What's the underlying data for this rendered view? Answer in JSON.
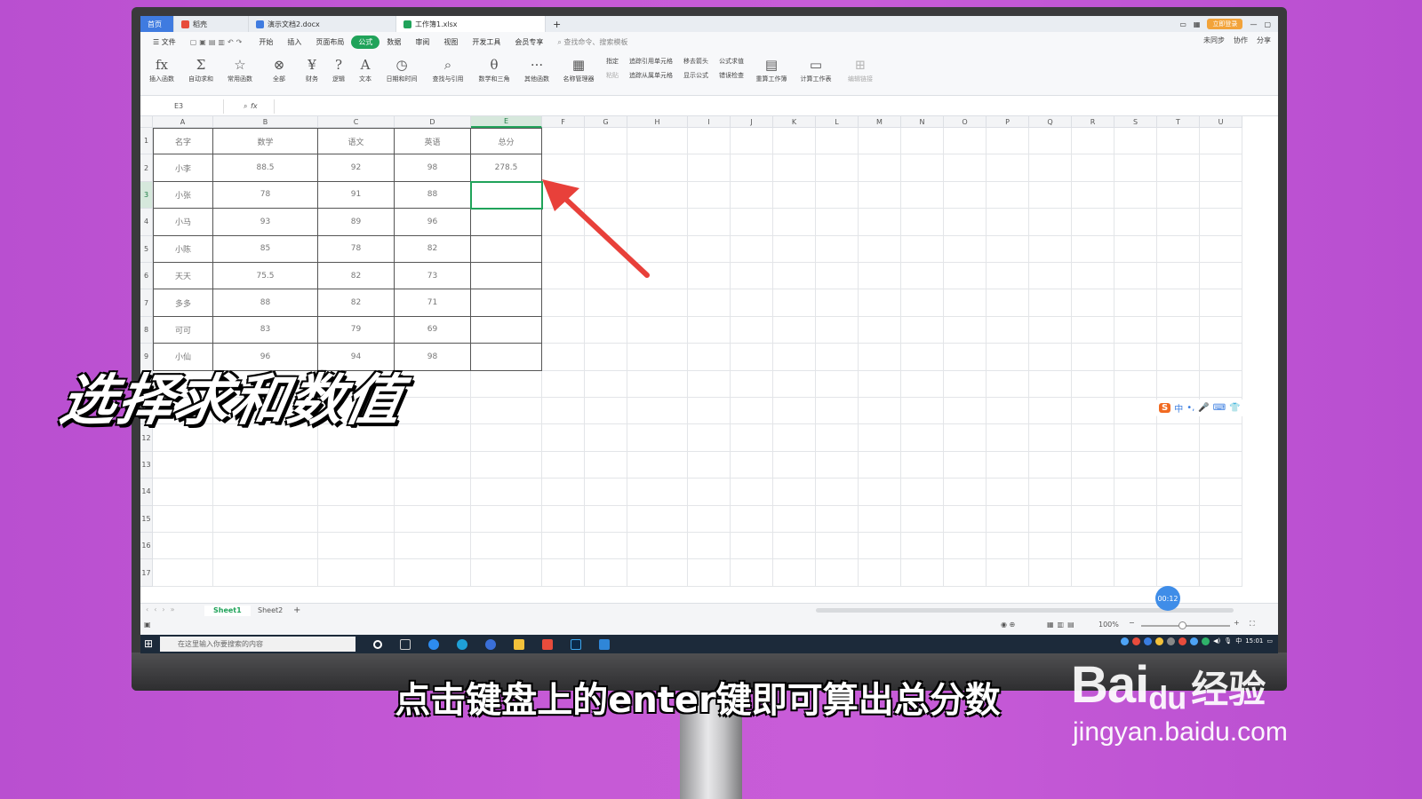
{
  "app": {
    "tabs": [
      {
        "label": "首页",
        "kind": "home"
      },
      {
        "label": "稻壳",
        "kind": "daoke"
      },
      {
        "label": "演示文档2.docx",
        "kind": "doc"
      },
      {
        "label": "工作簿1.xlsx",
        "kind": "xls"
      }
    ],
    "login_label": "立即登录",
    "menu": [
      "文件",
      "开始",
      "插入",
      "页面布局",
      "公式",
      "数据",
      "审阅",
      "视图",
      "开发工具",
      "会员专享"
    ],
    "active_menu": "公式",
    "search_placeholder": "查找命令、搜索模板",
    "right_actions": [
      "未同步",
      "协作",
      "分享"
    ],
    "ribbon_big": [
      {
        "label": "插入函数",
        "icon": "fx-icon",
        "glyph": "fx"
      },
      {
        "label": "自动求和",
        "icon": "sigma-icon",
        "glyph": "Σ"
      },
      {
        "label": "常用函数",
        "icon": "star-icon",
        "glyph": "☆"
      },
      {
        "label": "全部",
        "icon": "all-functions-icon",
        "glyph": "⊗"
      },
      {
        "label": "财务",
        "icon": "finance-icon",
        "glyph": "¥"
      },
      {
        "label": "逻辑",
        "icon": "logic-icon",
        "glyph": "?"
      },
      {
        "label": "文本",
        "icon": "text-icon",
        "glyph": "A"
      },
      {
        "label": "日期和时间",
        "icon": "clock-icon",
        "glyph": "◷"
      },
      {
        "label": "查找与引用",
        "icon": "lookup-icon",
        "glyph": "🔍"
      },
      {
        "label": "数学和三角",
        "icon": "math-icon",
        "glyph": "θ"
      },
      {
        "label": "其他函数",
        "icon": "more-icon",
        "glyph": "···"
      },
      {
        "label": "名称管理器",
        "icon": "name-manager-icon",
        "glyph": "▦"
      }
    ],
    "ribbon_small": [
      [
        "指定",
        "粘贴"
      ],
      [
        "追踪引用单元格",
        "追踪从属单元格"
      ],
      [
        "移去箭头",
        "显示公式"
      ],
      [
        "公式求值",
        "错误检查"
      ]
    ],
    "ribbon_tail": [
      {
        "label": "重算工作簿",
        "icon": "recalc-icon",
        "glyph": "▤"
      },
      {
        "label": "计算工作表",
        "icon": "calc-sheet-icon",
        "glyph": "▭"
      },
      {
        "label": "编辑链接",
        "icon": "edit-links-icon",
        "glyph": "⊞"
      }
    ],
    "namebox": "E3",
    "fx_label": "fx"
  },
  "sheet": {
    "columns": [
      "A",
      "B",
      "C",
      "D",
      "E",
      "F",
      "G",
      "H",
      "I",
      "J",
      "K",
      "L",
      "M",
      "N",
      "O",
      "P",
      "Q",
      "R",
      "S",
      "T",
      "U"
    ],
    "rows": [
      "1",
      "2",
      "3",
      "4",
      "5",
      "6",
      "7",
      "8",
      "9",
      "10",
      "11",
      "12",
      "13",
      "14",
      "15",
      "16",
      "17"
    ],
    "selected_col": "E",
    "selected_row": "3",
    "table": [
      [
        "名字",
        "数学",
        "语文",
        "英语",
        "总分"
      ],
      [
        "小李",
        "88.5",
        "92",
        "98",
        "278.5"
      ],
      [
        "小张",
        "78",
        "91",
        "88",
        ""
      ],
      [
        "小马",
        "93",
        "89",
        "96",
        ""
      ],
      [
        "小陈",
        "85",
        "78",
        "82",
        ""
      ],
      [
        "天天",
        "75.5",
        "82",
        "73",
        ""
      ],
      [
        "多多",
        "88",
        "82",
        "71",
        ""
      ],
      [
        "可可",
        "83",
        "79",
        "69",
        ""
      ],
      [
        "小仙",
        "96",
        "94",
        "98",
        ""
      ]
    ],
    "sheet_tabs": [
      "Sheet1",
      "Sheet2"
    ],
    "active_sheet": "Sheet1",
    "add_sheet": "+",
    "zoom": "100%"
  },
  "taskbar": {
    "search_placeholder": "在这里输入你要搜索的内容",
    "clock": "15:01",
    "ime": "中"
  },
  "ime_bar": {
    "logo": "S",
    "label": "中"
  },
  "timer": "00:12",
  "overlay": {
    "title": "选择求和数值",
    "subtitle": "点击键盘上的enter键即可算出总分数"
  },
  "watermark": {
    "brand": "Bai",
    "paw": "du",
    "cn": "经验",
    "url": "jingyan.baidu.com"
  },
  "colors": {
    "accent": "#20a35a",
    "arrow": "#e8403a",
    "background": "#c65ad6"
  }
}
